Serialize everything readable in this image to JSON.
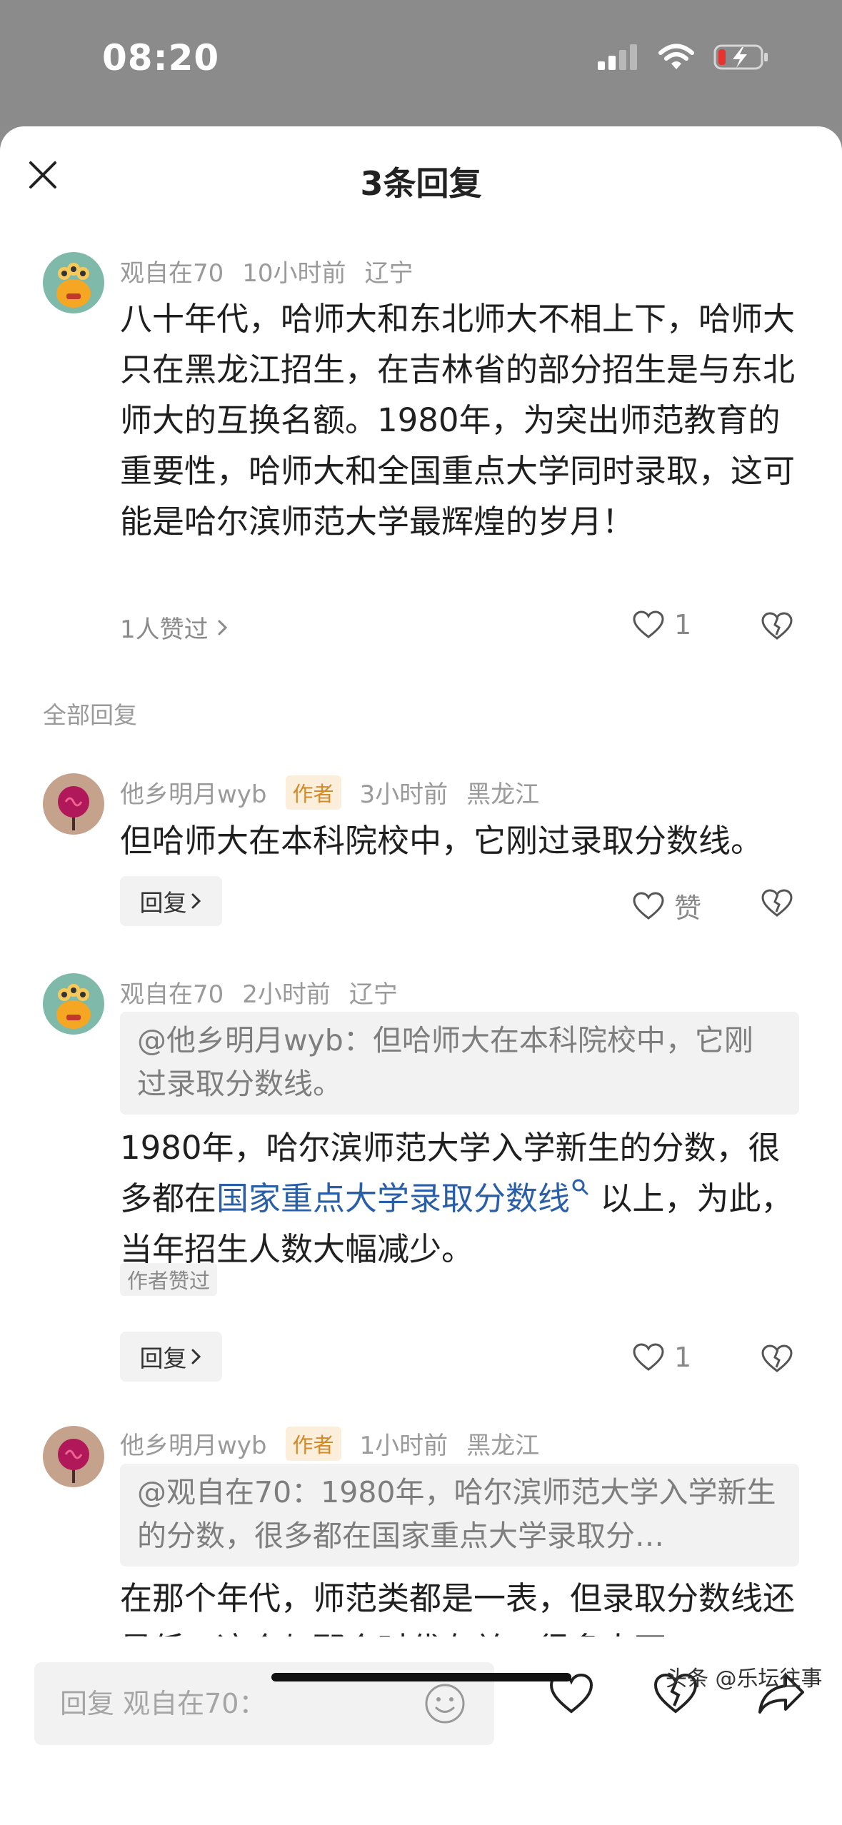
{
  "status_bar": {
    "time": "08:20"
  },
  "sheet": {
    "title": "3条回复"
  },
  "main_comment": {
    "username": "观自在70",
    "time": "10小时前",
    "location": "辽宁",
    "text": "八十年代，哈师大和东北师大不相上下，哈师大只在黑龙江招生，在吉林省的部分招生是与东北师大的互换名额。1980年，为突出师范教育的重要性，哈师大和全国重点大学同时录取，这可能是哈尔滨师范大学最辉煌的岁月！",
    "likes_text": "1人赞过",
    "like_count": "1"
  },
  "section_label": "全部回复",
  "replies": [
    {
      "username": "他乡明月wyb",
      "author_tag": "作者",
      "time": "3小时前",
      "location": "黑龙江",
      "text": "但哈师大在本科院校中，它刚过录取分数线。",
      "reply_label": "回复",
      "like_label": "赞"
    },
    {
      "username": "观自在70",
      "time": "2小时前",
      "location": "辽宁",
      "quote": "@他乡明月wyb：但哈师大在本科院校中，它刚过录取分数线。",
      "text_before_link": "1980年，哈尔滨师范大学入学新生的分数，很多都在",
      "link_text": "国家重点大学录取分数线",
      "text_after_link": " 以上，为此，当年招生人数大幅减少。",
      "author_liked": "作者赞过",
      "reply_label": "回复",
      "like_count": "1"
    },
    {
      "username": "他乡明月wyb",
      "author_tag": "作者",
      "time": "1小时前",
      "location": "黑龙江",
      "quote": "@观自在70：1980年，哈尔滨师范大学入学新生的分数，很多都在国家重点大学录取分…",
      "text": "在那个年代，师范类都是一表，但录取分数线还是低，这个与那个时代有关，很多人不"
    }
  ],
  "bottom_bar": {
    "input_placeholder": "回复 观自在70："
  },
  "watermark": "头条 @乐坛往事",
  "colors": {
    "link": "#2a5fa8",
    "author_tag_text": "#d58a2a",
    "author_tag_bg": "#fbeedb",
    "battery_low": "#e8322e"
  }
}
